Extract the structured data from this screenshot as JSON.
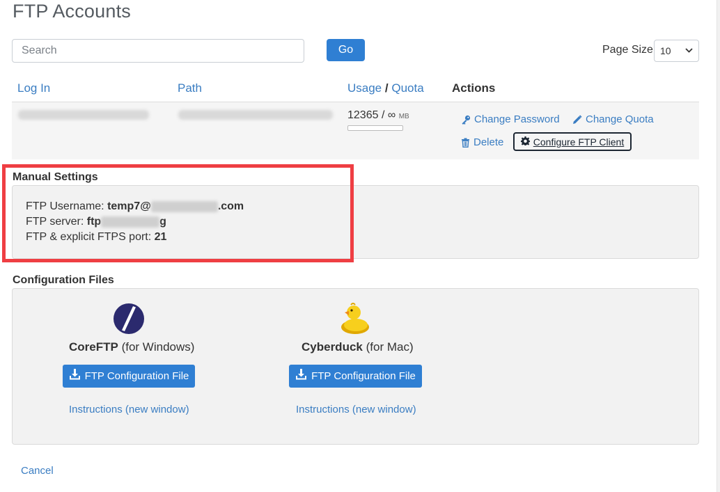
{
  "page": {
    "title": "FTP Accounts"
  },
  "search": {
    "placeholder": "Search",
    "go_label": "Go"
  },
  "page_size": {
    "label": "Page Size",
    "value": "10"
  },
  "table": {
    "columns": {
      "login": "Log In",
      "path": "Path",
      "usage": "Usage",
      "slash": "/",
      "quota": "Quota",
      "actions": "Actions"
    },
    "row": {
      "usage_value": "12365 / ∞",
      "usage_unit": "MB",
      "usage_fraction": 0
    },
    "actions": {
      "change_password": "Change Password",
      "change_quota": "Change Quota",
      "delete": "Delete",
      "configure": "Configure FTP Client"
    }
  },
  "manual": {
    "heading": "Manual Settings",
    "username_label": "FTP Username:",
    "username_value_a": "temp7@",
    "username_value_b": ".com",
    "server_label": "FTP server:",
    "server_value_a": "ftp",
    "server_value_b": "g",
    "port_label": "FTP & explicit FTPS port:",
    "port_value": "21"
  },
  "config": {
    "heading": "Configuration Files",
    "clients": [
      {
        "name": "CoreFTP",
        "platform": "(for Windows)",
        "button": "FTP Configuration File",
        "instructions": "Instructions (new window)"
      },
      {
        "name": "Cyberduck",
        "platform": "(for Mac)",
        "button": "FTP Configuration File",
        "instructions": "Instructions (new window)"
      }
    ]
  },
  "cancel_label": "Cancel",
  "colors": {
    "accent": "#2f7fd3",
    "link": "#3a7dc2",
    "highlight": "#ef3e43"
  },
  "icons": [
    "key-icon",
    "pencil-icon",
    "trash-icon",
    "gear-icon",
    "download-icon",
    "coreftp-logo-icon",
    "cyberduck-logo-icon",
    "chevron-down-icon"
  ]
}
